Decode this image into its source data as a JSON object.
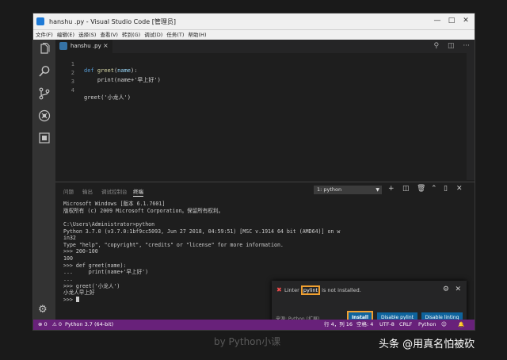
{
  "window": {
    "title": "hanshu .py - Visual Studio Code [管理员]",
    "controls": [
      "—",
      "□",
      "✕"
    ]
  },
  "menubar": {
    "items": [
      "文件(F)",
      "编辑(E)",
      "选择(S)",
      "查看(V)",
      "转到(G)",
      "调试(D)",
      "任务(T)",
      "帮助(H)"
    ]
  },
  "activity": {
    "icons": [
      "files-icon",
      "search-icon",
      "source-control-icon",
      "debug-icon",
      "extensions-icon",
      "settings-gear-icon"
    ]
  },
  "tab": {
    "filename": "hanshu .py",
    "close": "×"
  },
  "editor": {
    "lines": [
      {
        "num": "1",
        "kw": "def ",
        "fn": "greet",
        "rest": "(",
        "var": "name",
        "tail": "):"
      },
      {
        "num": "2",
        "code": "    print(name+'早上好')"
      },
      {
        "num": "3",
        "code": ""
      },
      {
        "num": "4",
        "code": "greet('小龙人')"
      }
    ]
  },
  "panel": {
    "tabs": [
      "问题",
      "输出",
      "调试控制台",
      "终端"
    ],
    "active_tab": "终端",
    "terminal_select": "1: python",
    "terminal_lines": [
      "Microsoft Windows [版本 6.1.7601]",
      "版权所有 (c) 2009 Microsoft Corporation。保留所有权利。",
      "",
      "C:\\Users\\Administrator>python",
      "Python 3.7.0 (v3.7.0:1bf9cc5093, Jun 27 2018, 04:59:51) [MSC v.1914 64 bit (AMD64)] on w",
      "in32",
      "Type \"help\", \"copyright\", \"credits\" or \"license\" for more information.",
      ">>> 200-100",
      "100",
      ">>> def greet(name):",
      "...     print(name+'早上好')",
      "...",
      ">>> greet('小龙人')",
      "小龙人早上好",
      ">>> "
    ]
  },
  "notification": {
    "prefix": "Linter ",
    "highlight": "pylint",
    "suffix": " is not installed.",
    "source": "来源: Python (扩展)",
    "buttons": {
      "install": "Install",
      "disable_pylint": "Disable pylint",
      "disable_linting": "Disable linting"
    }
  },
  "statusbar": {
    "errors": "⊗ 0",
    "warnings": "⚠ 0",
    "interpreter": "Python 3.7 (64-bit)",
    "position": "行 4，列 16",
    "spaces": "空格: 4",
    "encoding": "UTF-8",
    "eol": "CRLF",
    "language": "Python"
  },
  "watermark": "by Python小课",
  "credit": "头条 @用真名怕被砍"
}
